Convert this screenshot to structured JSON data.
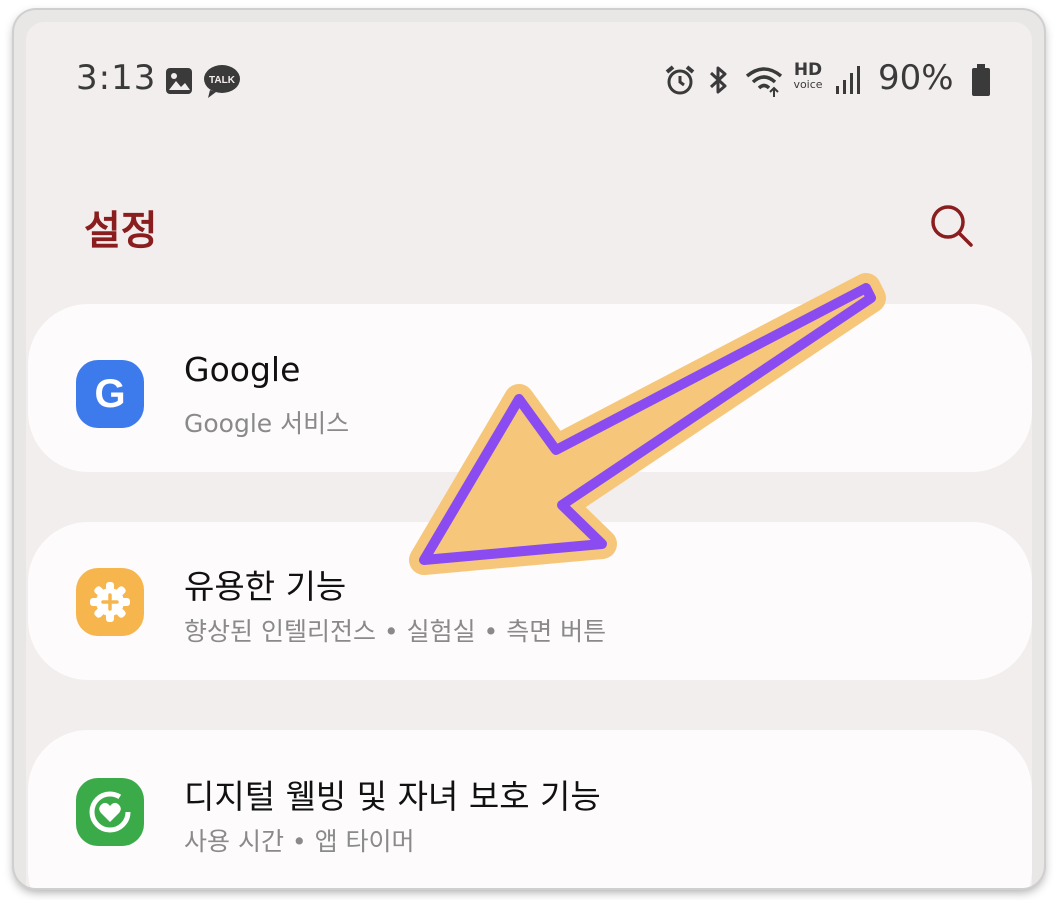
{
  "status_bar": {
    "time": "3:13",
    "battery": "90%",
    "hd_label": "HD",
    "voice_label": "voice",
    "talk_label": "TALK",
    "icons": [
      "gallery-icon",
      "kakaotalk-icon",
      "alarm-icon",
      "bluetooth-icon",
      "wifi-icon",
      "hd-voice-icon",
      "signal-icon",
      "battery-icon"
    ]
  },
  "header": {
    "title": "설정",
    "search_icon": "search-icon"
  },
  "items": [
    {
      "title": "Google",
      "subtitle": "Google 서비스",
      "icon": "google-icon",
      "icon_letter": "G",
      "color": "#3d7bec"
    },
    {
      "title": "유용한 기능",
      "subtitle": "향상된 인텔리전스 • 실험실 • 측면 버튼",
      "icon": "advanced-features-icon",
      "color": "#f7b64d"
    },
    {
      "title": "디지털 웰빙 및 자녀 보호 기능",
      "subtitle": "사용 시간 • 앱 타이머",
      "icon": "digital-wellbeing-icon",
      "color": "#3bab4a"
    }
  ],
  "colors": {
    "title": "#8a1e1e",
    "background": "#f3eeee",
    "card": "#fdfbfb",
    "arrow_fill": "#f6c77a",
    "arrow_stroke": "#8a4cf0"
  },
  "annotation": {
    "icon": "arrow-annotation-icon"
  }
}
